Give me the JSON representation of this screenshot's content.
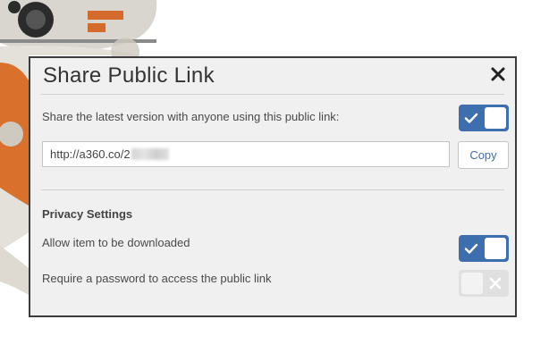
{
  "dialog": {
    "title": "Share Public Link",
    "close_icon": "close-icon"
  },
  "share": {
    "label": "Share the latest version with anyone using this public link:",
    "enabled": true,
    "url": "http://a360.co/2",
    "copy_label": "Copy"
  },
  "privacy": {
    "heading": "Privacy Settings",
    "download_label": "Allow item to be downloaded",
    "download_enabled": true,
    "password_label": "Require a password to access the public link",
    "password_enabled": false
  },
  "colors": {
    "accent": "#3d6eae",
    "toggle_off": "#e0e0e0",
    "dialog_bg": "#f0f0f0",
    "border": "#3c3c3c"
  }
}
